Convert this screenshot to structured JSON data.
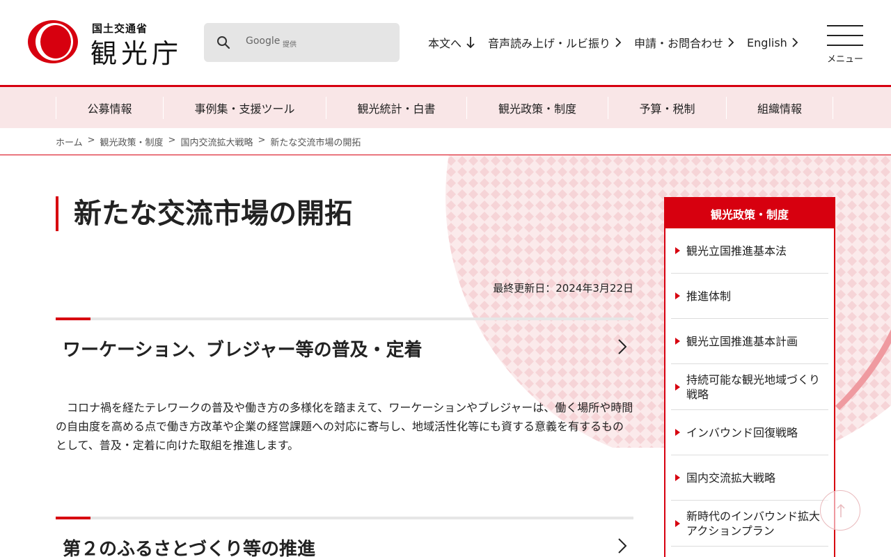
{
  "header": {
    "logo_sub": "国土交通省",
    "logo_main": "観光庁",
    "search": {
      "google": "Google",
      "provided": "提供",
      "placeholder": ""
    },
    "links": [
      {
        "label": "本文へ",
        "icon": "arrow-down-icon"
      },
      {
        "label": "音声読み上げ・ルビ振り",
        "icon": "chevron-right-icon"
      },
      {
        "label": "申請・お問合わせ",
        "icon": "chevron-right-icon"
      },
      {
        "label": "English",
        "icon": "chevron-right-icon"
      }
    ],
    "menu_label": "メニュー"
  },
  "nav": {
    "items": [
      "公募情報",
      "事例集・支援ツール",
      "観光統計・白書",
      "観光政策・制度",
      "予算・税制",
      "組織情報"
    ]
  },
  "breadcrumb": {
    "items": [
      "ホーム",
      "観光政策・制度",
      "国内交流拡大戦略",
      "新たな交流市場の開拓"
    ],
    "separator": ">"
  },
  "main": {
    "title": "新たな交流市場の開拓",
    "updated": "最終更新日：2024年3月22日",
    "sections": [
      {
        "title": "ワーケーション、ブレジャー等の普及・定着",
        "body": "　コロナ禍を経たテレワークの普及や働き方の多様化を踏まえて、ワーケーションやブレジャーは、働く場所や時間の自由度を高める点で働き方改革や企業の経営課題への対応に寄与し、地域活性化等にも資する意義を有するものとして、普及・定着に向けた取組を推進します。"
      },
      {
        "title": "第２のふるさとづくり等の推進"
      }
    ]
  },
  "sidebar": {
    "title": "観光政策・制度",
    "items": [
      "観光立国推進基本法",
      "推進体制",
      "観光立国推進基本計画",
      "持続可能な観光地域づくり戦略",
      "インバウンド回復戦略",
      "国内交流拡大戦略",
      "新時代のインバウンド拡大アクションプラン"
    ]
  },
  "colors": {
    "accent": "#d7000f",
    "nav_bg": "#f9e6e7",
    "pattern": "#f7d9db"
  }
}
